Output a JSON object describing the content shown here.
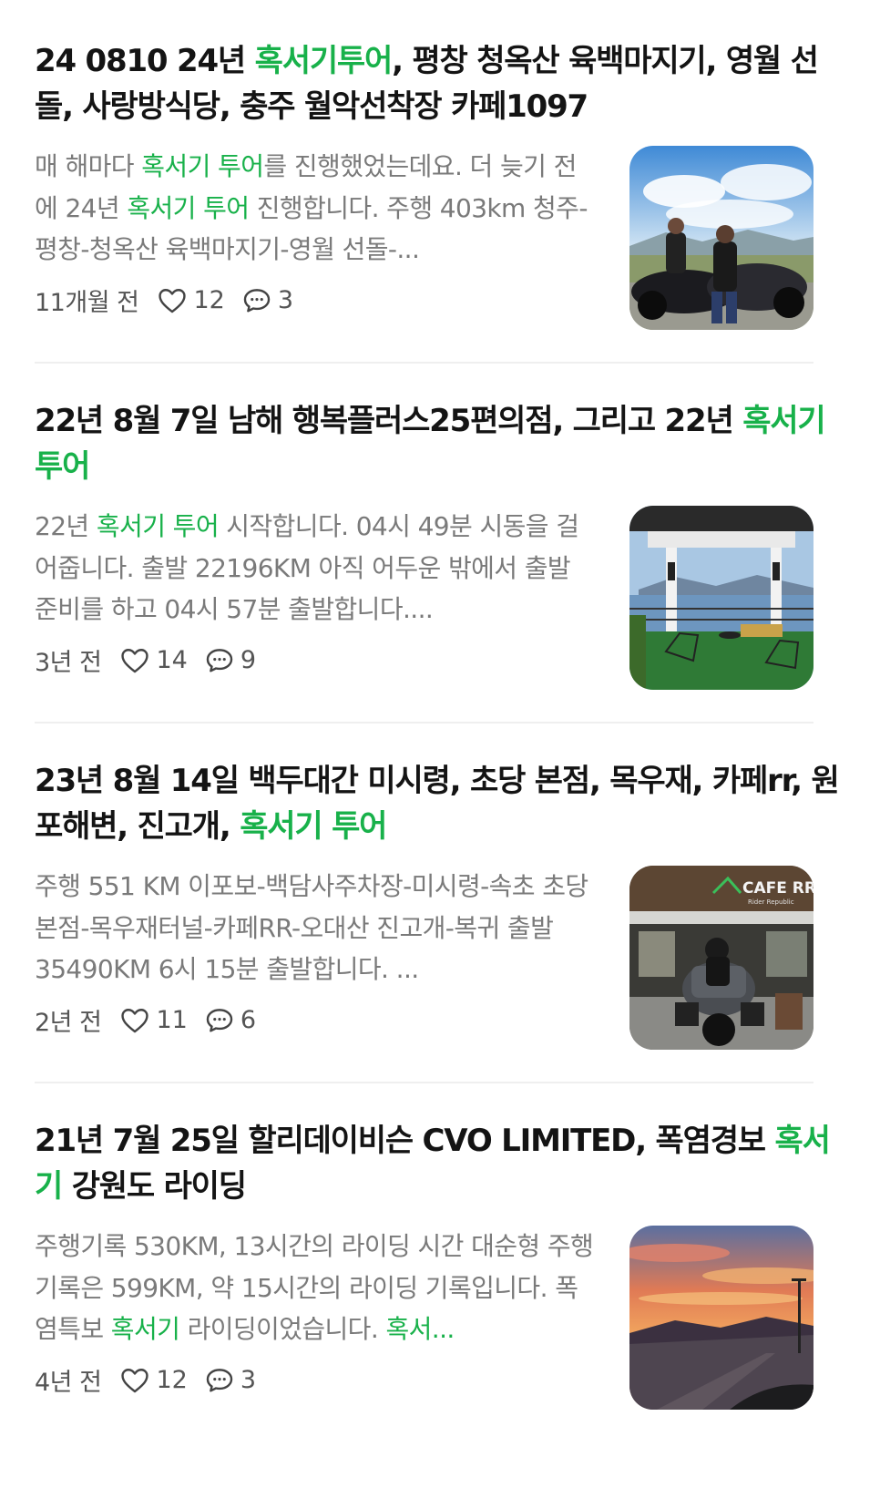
{
  "posts": [
    {
      "title_parts": [
        "24 0810 24년 ",
        "혹서기투어",
        ", 평창 청옥산 육백마지기, 영월 선돌, 사랑방식당, 충주 월악선착장 카페1097"
      ],
      "excerpt_parts": [
        "매 해마다 ",
        "혹서기 투어",
        "를 진행했었는데요. 더 늦기 전에 24년 ",
        "혹서기 투어",
        " 진행합니다. 주행 403km 청주-평창-청옥산 육백마지기-영월 선돌-..."
      ],
      "ago": "11개월 전",
      "likes": "12",
      "comments": "3",
      "thumb": "motorcycle-riders-mountain-photo"
    },
    {
      "title_parts": [
        "22년 8월 7일 남해 행복플러스25편의점, 그리고 22년 ",
        "혹서기 투어"
      ],
      "excerpt_parts": [
        "22년 ",
        "혹서기 투어",
        " 시작합니다. 04시 49분 시동을 걸어줍니다. 출발 22196KM 아직 어두운 밖에서 출발 준비를 하고 04시 57분 출발합니다...."
      ],
      "ago": "3년 전",
      "likes": "14",
      "comments": "9",
      "thumb": "seaside-terrace-photo"
    },
    {
      "title_parts": [
        "23년 8월 14일 백두대간 미시령, 초당 본점, 목우재, 카페rr, 원포해변, 진고개, ",
        "혹서기 투어"
      ],
      "excerpt_parts": [
        "주행 551 KM 이포보-백담사주차장-미시령-속초 초당본점-목우재터널-카페RR-오대산 진고개-복귀 출발 35490KM 6시 15분 출발합니다. ..."
      ],
      "ago": "2년 전",
      "likes": "11",
      "comments": "6",
      "thumb": "cafe-rr-motorcycle-photo",
      "thumb_sign": "CAFE RR",
      "thumb_sign_sub": "Rider Republic"
    },
    {
      "title_parts": [
        "21년 7월 25일 할리데이비슨 CVO LIMITED, 폭염경보 ",
        "혹서기",
        " 강원도 라이딩"
      ],
      "excerpt_parts": [
        "주행기록 530KM, 13시간의 라이딩 시간 대순형 주행기록은 599KM, 약 15시간의 라이딩 기록입니다. 폭염특보 ",
        "혹서기",
        " 라이딩이었습니다. ",
        "혹서..."
      ],
      "ago": "4년 전",
      "likes": "12",
      "comments": "3",
      "thumb": "sunset-road-photo"
    }
  ],
  "colors": {
    "highlight": "#18b14a",
    "title": "#141414",
    "excerpt": "#7a7a7a",
    "meta": "#555555"
  }
}
